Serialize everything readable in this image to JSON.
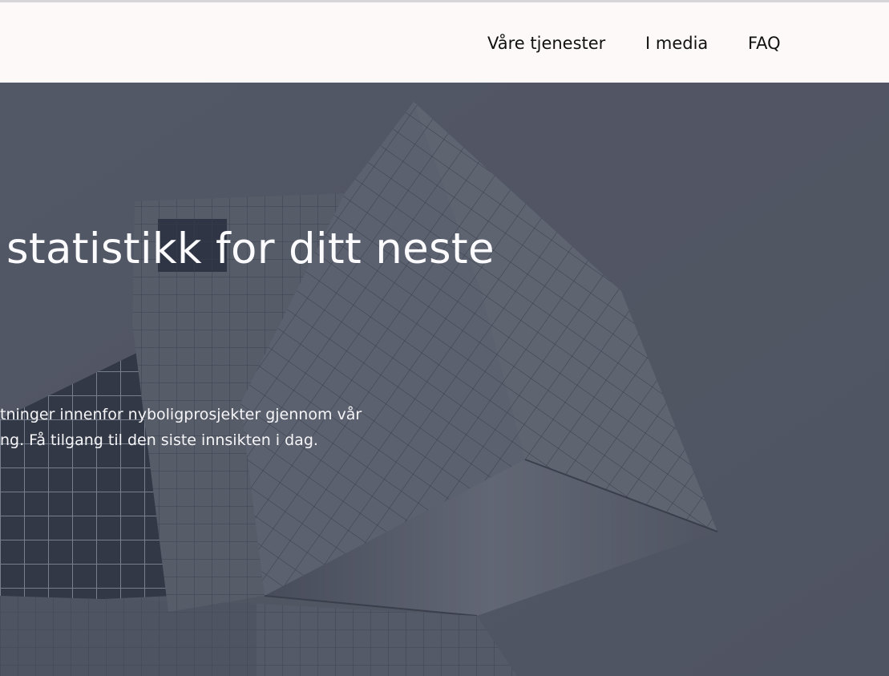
{
  "nav": {
    "items": [
      {
        "label": "Våre tjenester"
      },
      {
        "label": "I media"
      },
      {
        "label": "FAQ"
      }
    ]
  },
  "hero": {
    "headline": "statistikk for ditt neste",
    "lede_line1": "tninger innenfor nyboligprosjekter gjennom vår",
    "lede_line2": "ng. Få tilgang til den siste innsikten i dag.",
    "background": "building-photo"
  },
  "colors": {
    "header_bg": "#fdf9f9",
    "overlay": "#4b505e",
    "text_light": "#fbfbfd"
  }
}
